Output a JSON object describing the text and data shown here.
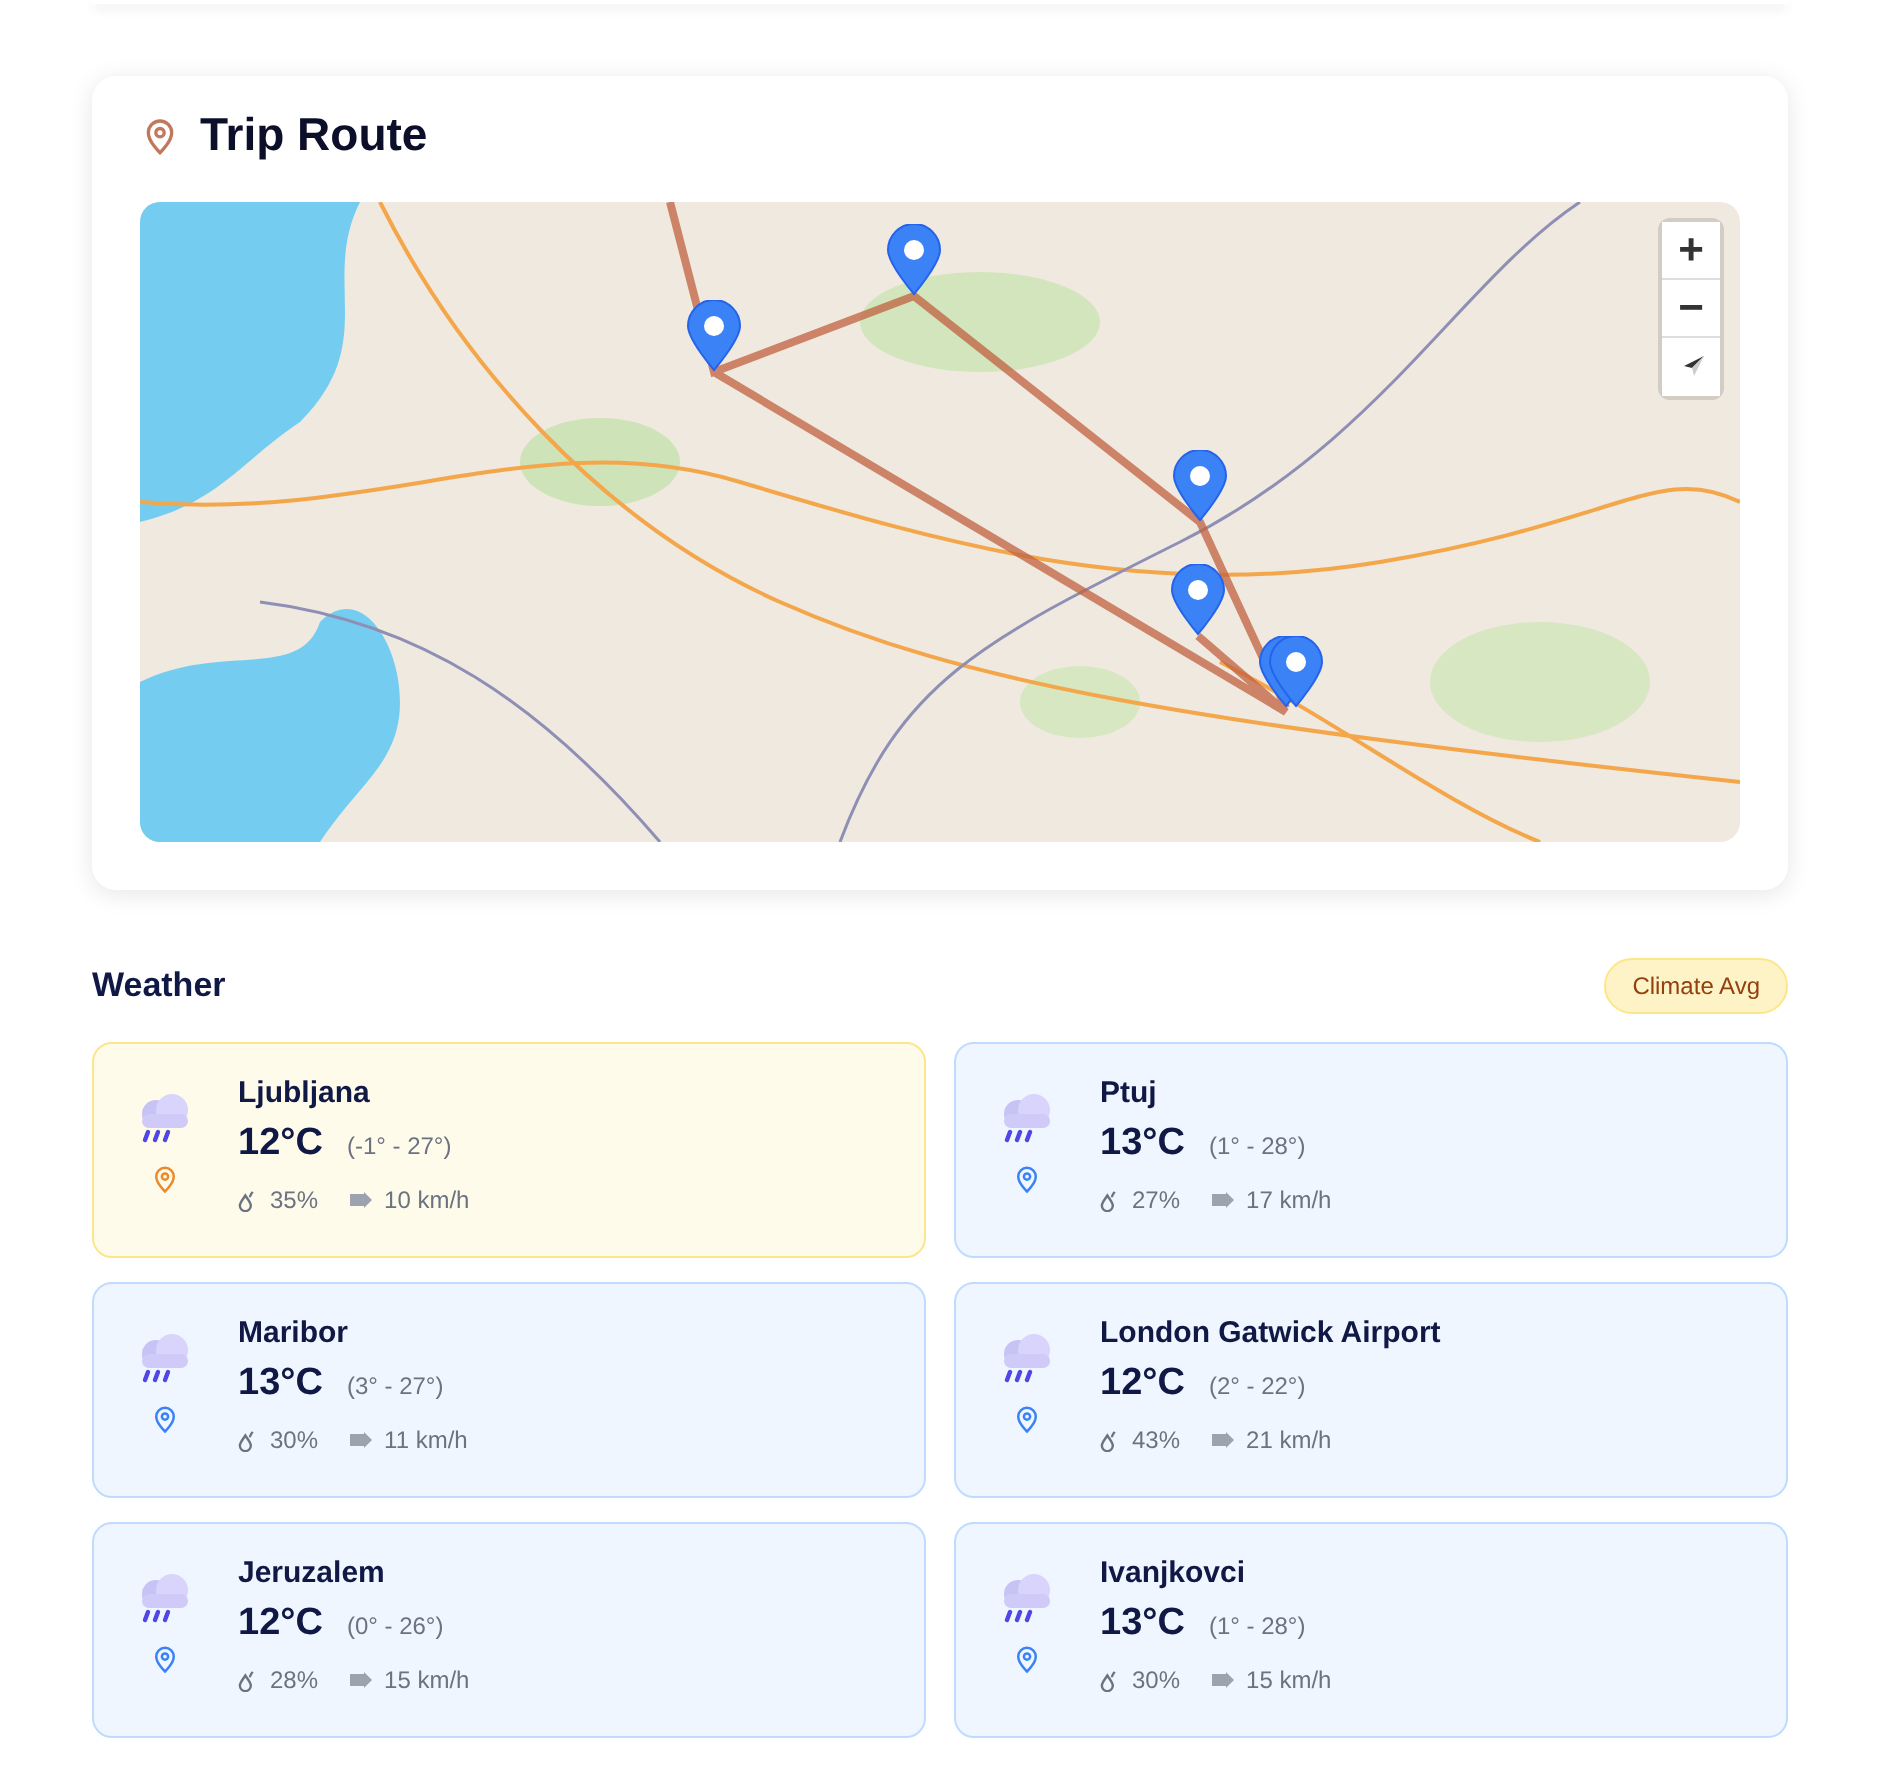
{
  "route": {
    "title": "Trip Route",
    "map_controls": [
      {
        "kind": "zoom_in",
        "label": "+"
      },
      {
        "kind": "zoom_out",
        "label": "−"
      },
      {
        "kind": "compass"
      }
    ]
  },
  "weather": {
    "title": "Weather",
    "badge": "Climate Avg",
    "cards": [
      {
        "city": "Ljubljana",
        "temp": "12°C",
        "range": "(-1° - 27°)",
        "humidity": "35%",
        "wind": "10 km/h",
        "selected": true
      },
      {
        "city": "Ptuj",
        "temp": "13°C",
        "range": "(1° - 28°)",
        "humidity": "27%",
        "wind": "17 km/h",
        "selected": false
      },
      {
        "city": "Maribor",
        "temp": "13°C",
        "range": "(3° - 27°)",
        "humidity": "30%",
        "wind": "11 km/h",
        "selected": false
      },
      {
        "city": "London Gatwick Airport",
        "temp": "12°C",
        "range": "(2° - 22°)",
        "humidity": "43%",
        "wind": "21 km/h",
        "selected": false
      },
      {
        "city": "Jeruzalem",
        "temp": "12°C",
        "range": "(0° - 26°)",
        "humidity": "28%",
        "wind": "15 km/h",
        "selected": false
      },
      {
        "city": "Ivanjkovci",
        "temp": "13°C",
        "range": "(1° - 28°)",
        "humidity": "30%",
        "wind": "15 km/h",
        "selected": false
      }
    ]
  }
}
